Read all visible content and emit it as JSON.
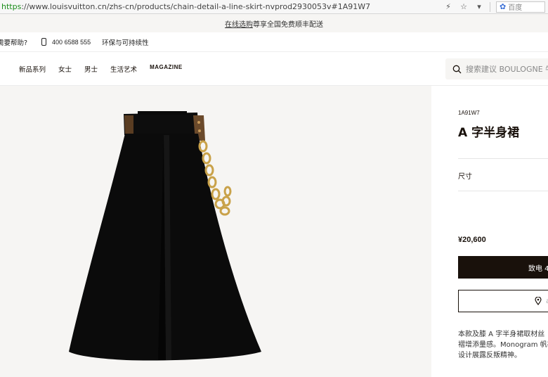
{
  "browser": {
    "url_scheme": "https",
    "url_rest": "://www.louisvuitton.cn/zhs-cn/products/chain-detail-a-line-skirt-nvprod2930053v#1A91W7",
    "search_engine": "百度"
  },
  "promo": {
    "link": "在线选购",
    "text": " 尊享全国免费顺丰配送"
  },
  "utility": {
    "help": "需要帮助?",
    "phone": "400 6588 555",
    "sustainability": "环保与可持续性"
  },
  "nav": {
    "items": [
      "新品系列",
      "女士",
      "男士",
      "生活艺术",
      "MAGAZINE"
    ],
    "search_placeholder": "搜索建议  BOULOGNE 牛"
  },
  "product": {
    "sku": "1A91W7",
    "title": "A 字半身裙",
    "size_label": "尺寸",
    "price": "¥20,600",
    "call_button": "致电 4",
    "store_button": "a",
    "description": [
      "本款及膝 A 字半身裙取材丝",
      "褶增添量感。Monogram 帆布",
      "设计展露反叛精神。"
    ]
  },
  "colors": {
    "dark": "#19110b",
    "panel": "#f6f5f3",
    "gold": "#c9a24a",
    "canvas": "#6b4a2b"
  }
}
